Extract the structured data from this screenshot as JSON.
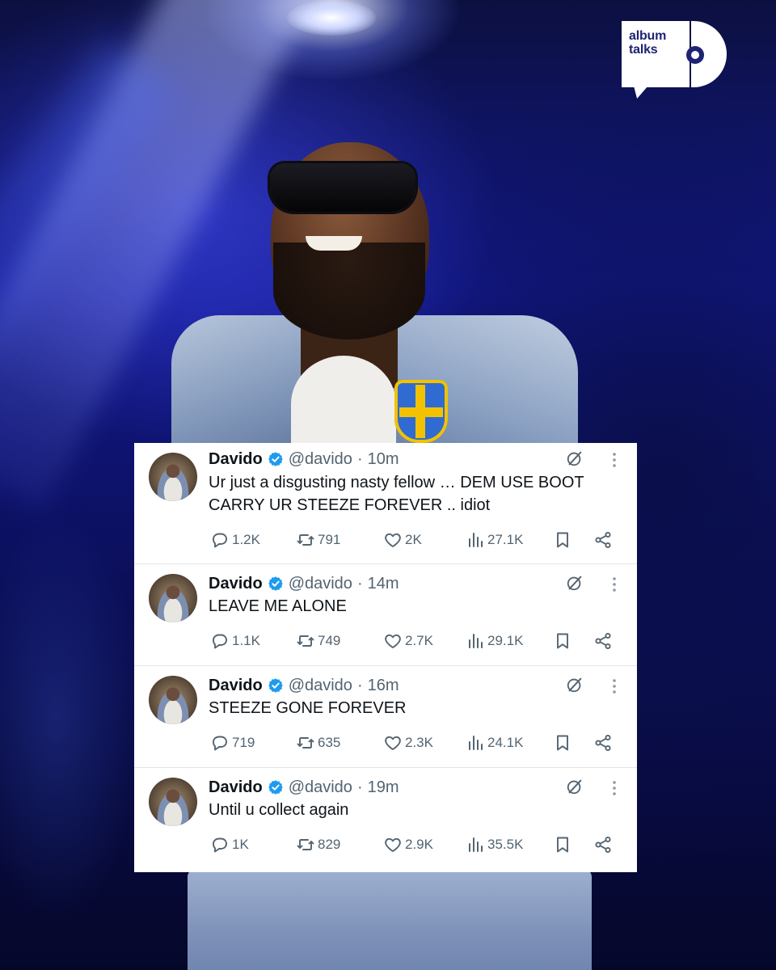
{
  "brand": {
    "logo_text": "album\ntalks",
    "colors": {
      "logo_bg": "#ffffff",
      "logo_text": "#1e2373",
      "verified": "#1d9bf0"
    }
  },
  "tweets": [
    {
      "name": "Davido",
      "handle": "@davido",
      "separator": "·",
      "time": "10m",
      "text": "Ur just a disgusting nasty fellow … DEM USE BOOT CARRY UR STEEZE FOREVER .. idiot",
      "replies": "1.2K",
      "reposts": "791",
      "likes": "2K",
      "views": "27.1K"
    },
    {
      "name": "Davido",
      "handle": "@davido",
      "separator": "·",
      "time": "14m",
      "text": "LEAVE ME ALONE",
      "replies": "1.1K",
      "reposts": "749",
      "likes": "2.7K",
      "views": "29.1K"
    },
    {
      "name": "Davido",
      "handle": "@davido",
      "separator": "·",
      "time": "16m",
      "text": "STEEZE GONE FOREVER",
      "replies": "719",
      "reposts": "635",
      "likes": "2.3K",
      "views": "24.1K"
    },
    {
      "name": "Davido",
      "handle": "@davido",
      "separator": "·",
      "time": "19m",
      "text": "Until u collect again",
      "replies": "1K",
      "reposts": "829",
      "likes": "2.9K",
      "views": "35.5K"
    }
  ],
  "icons": {
    "verified": "verified-badge-icon",
    "grok": "grok-icon",
    "more": "more-options-icon",
    "reply": "reply-icon",
    "repost": "repost-icon",
    "like": "heart-icon",
    "views": "views-icon",
    "bookmark": "bookmark-icon",
    "share": "share-icon"
  }
}
